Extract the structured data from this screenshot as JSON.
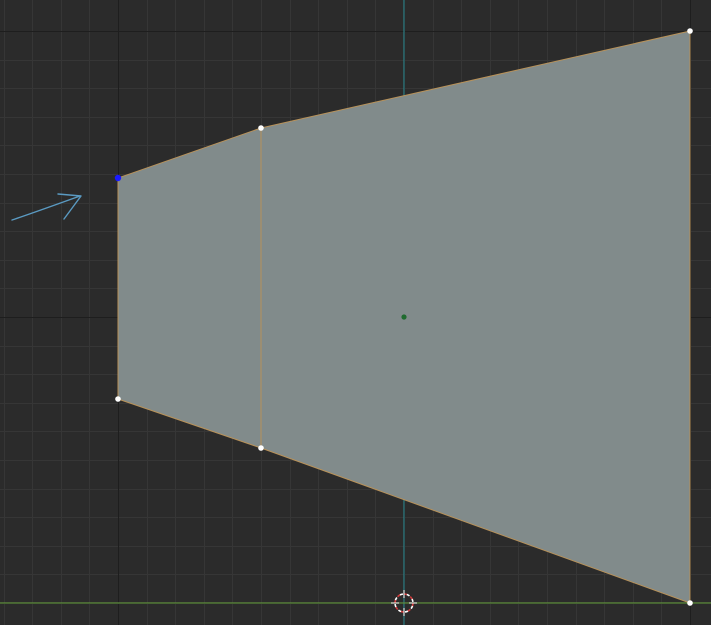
{
  "viewport": {
    "view": "top-orthographic",
    "mode": "edit-mesh",
    "selection_mode": "vertex",
    "selected_vertex_count": 1
  },
  "colors": {
    "background": "#2b2b2b",
    "grid_minor": "#363636",
    "grid_major": "#1e1e1e",
    "x_axis": "#5f8f3e",
    "y_axis": "#2f7f86",
    "face": "#818b8b",
    "edge": "#b8925a",
    "vertex": "#ffffff",
    "vertex_selected": "#1a1aff",
    "origin": "#1f6b2f",
    "cursor_red": "#d23c3c",
    "cursor_white": "#ffffff",
    "annotation_stroke": "#5a9ac2"
  },
  "annotation": {
    "shape": "arrow",
    "points_at": "selected-vertex"
  }
}
